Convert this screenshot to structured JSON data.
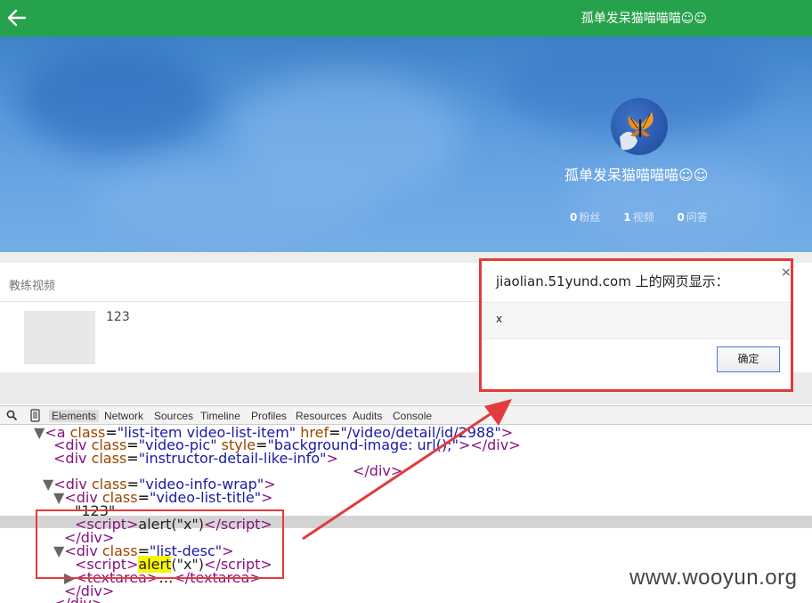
{
  "header": {
    "title": "孤单发呆猫喵喵喵☺☺",
    "back_icon": "arrow-left-icon",
    "bg_color": "#27a24c"
  },
  "profile": {
    "name": "孤单发呆猫喵喵喵☺☺",
    "stats": [
      {
        "count": "0",
        "label": "粉丝"
      },
      {
        "count": "1",
        "label": "视频"
      },
      {
        "count": "0",
        "label": "问答"
      }
    ]
  },
  "content": {
    "section_title": "教练视频",
    "items": [
      {
        "title": "123"
      }
    ]
  },
  "dialog": {
    "title": "jiaolian.51yund.com 上的网页显示：",
    "message": "x",
    "ok_label": "确定",
    "close_label": "×"
  },
  "devtools": {
    "tabs": [
      "Elements",
      "Network",
      "Sources",
      "Timeline",
      "Profiles",
      "Resources",
      "Audits",
      "Console"
    ],
    "active_tab": "Elements"
  },
  "code": {
    "l1": "\"list-item video-list-item\"",
    "l1b": "\"/video/detail/id/2988\"",
    "l2": "\"video-pic\"",
    "l2b": "\"background-image: url();\"",
    "l3": "\"instructor-detail-like-info\"",
    "l5": "\"video-info-wrap\"",
    "l6": "\"video-list-title\"",
    "l7": "\"123\"",
    "script_call": "alert(\"x\")",
    "l10": "\"list-desc\"",
    "alert_word": "alert",
    "alert_arg": "(\"x\")"
  },
  "watermark": "www.wooyun.org",
  "accent_colors": {
    "highlight_box": "#e23b3b",
    "search_highlight": "#f7f700"
  }
}
